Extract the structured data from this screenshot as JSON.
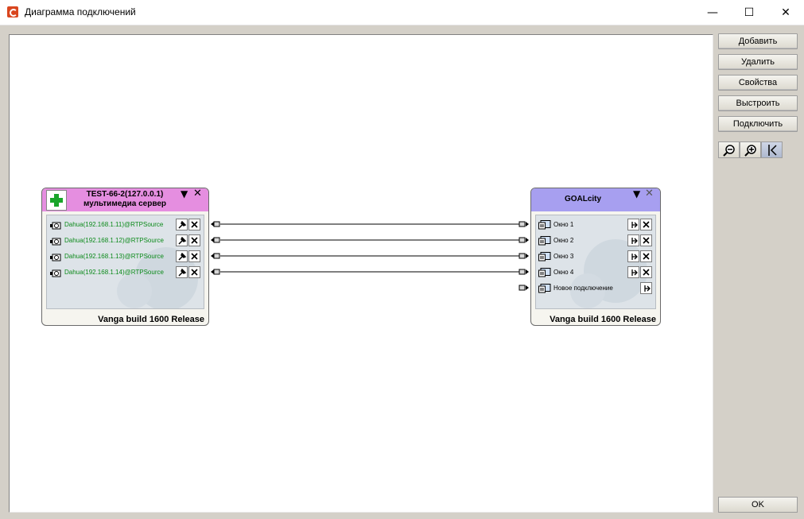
{
  "window": {
    "title": "Диаграмма подключений",
    "minimize_glyph": "—",
    "maximize_glyph": "☐",
    "close_glyph": "✕"
  },
  "toolbar": {
    "add_label": "Добавить",
    "delete_label": "Удалить",
    "properties_label": "Свойства",
    "arrange_label": "Выстроить",
    "connect_label": "Подключить",
    "zoom_out_icon": "zoom-out-icon",
    "zoom_in_icon": "zoom-in-icon",
    "connect_mode_icon": "connect-mode-icon"
  },
  "ok_label": "OK",
  "source_node": {
    "title": "TEST-66-2(127.0.0.1)",
    "subtitle": "мультимедиа сервер",
    "footer": "Vanga build 1600 Release",
    "header_color": "#e58ee0",
    "rows": [
      {
        "label": "Dahua(192.168.1.11)@RTPSource"
      },
      {
        "label": "Dahua(192.168.1.12)@RTPSource"
      },
      {
        "label": "Dahua(192.168.1.13)@RTPSource"
      },
      {
        "label": "Dahua(192.168.1.14)@RTPSource"
      }
    ],
    "row_text_color": "#0b8a1a"
  },
  "target_node": {
    "title": "GOALcity",
    "footer": "Vanga build 1600 Release",
    "header_color": "#a79ff0",
    "rows": [
      {
        "label": "Окно 1"
      },
      {
        "label": "Окно 2"
      },
      {
        "label": "Окно 3"
      },
      {
        "label": "Окно 4"
      },
      {
        "label": "Новое подключение"
      }
    ]
  }
}
